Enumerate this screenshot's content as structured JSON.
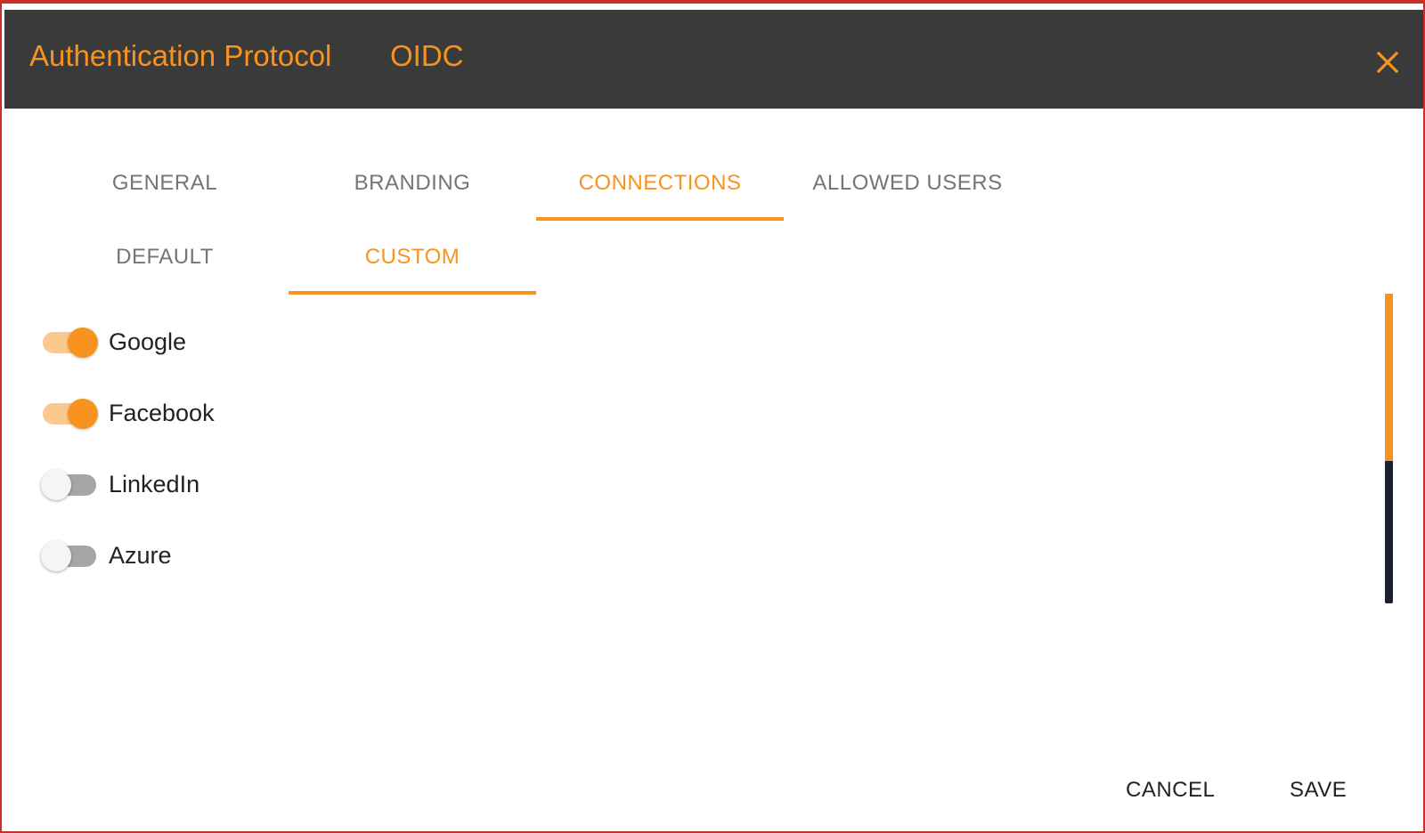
{
  "dialog": {
    "title": "Authentication Protocol",
    "protocol": "OIDC",
    "close_icon": "close-icon",
    "accent_color": "#f7931e",
    "header_color": "#3a3a3a"
  },
  "tabs": [
    {
      "label": "GENERAL",
      "active": false
    },
    {
      "label": "BRANDING",
      "active": false
    },
    {
      "label": "CONNECTIONS",
      "active": true
    },
    {
      "label": "ALLOWED USERS",
      "active": false
    }
  ],
  "subtabs": [
    {
      "label": "DEFAULT",
      "active": false
    },
    {
      "label": "CUSTOM",
      "active": true
    }
  ],
  "connections": [
    {
      "label": "Google",
      "enabled": true
    },
    {
      "label": "Facebook",
      "enabled": true
    },
    {
      "label": "LinkedIn",
      "enabled": false
    },
    {
      "label": "Azure",
      "enabled": false
    }
  ],
  "footer": {
    "cancel_label": "CANCEL",
    "save_label": "SAVE"
  }
}
